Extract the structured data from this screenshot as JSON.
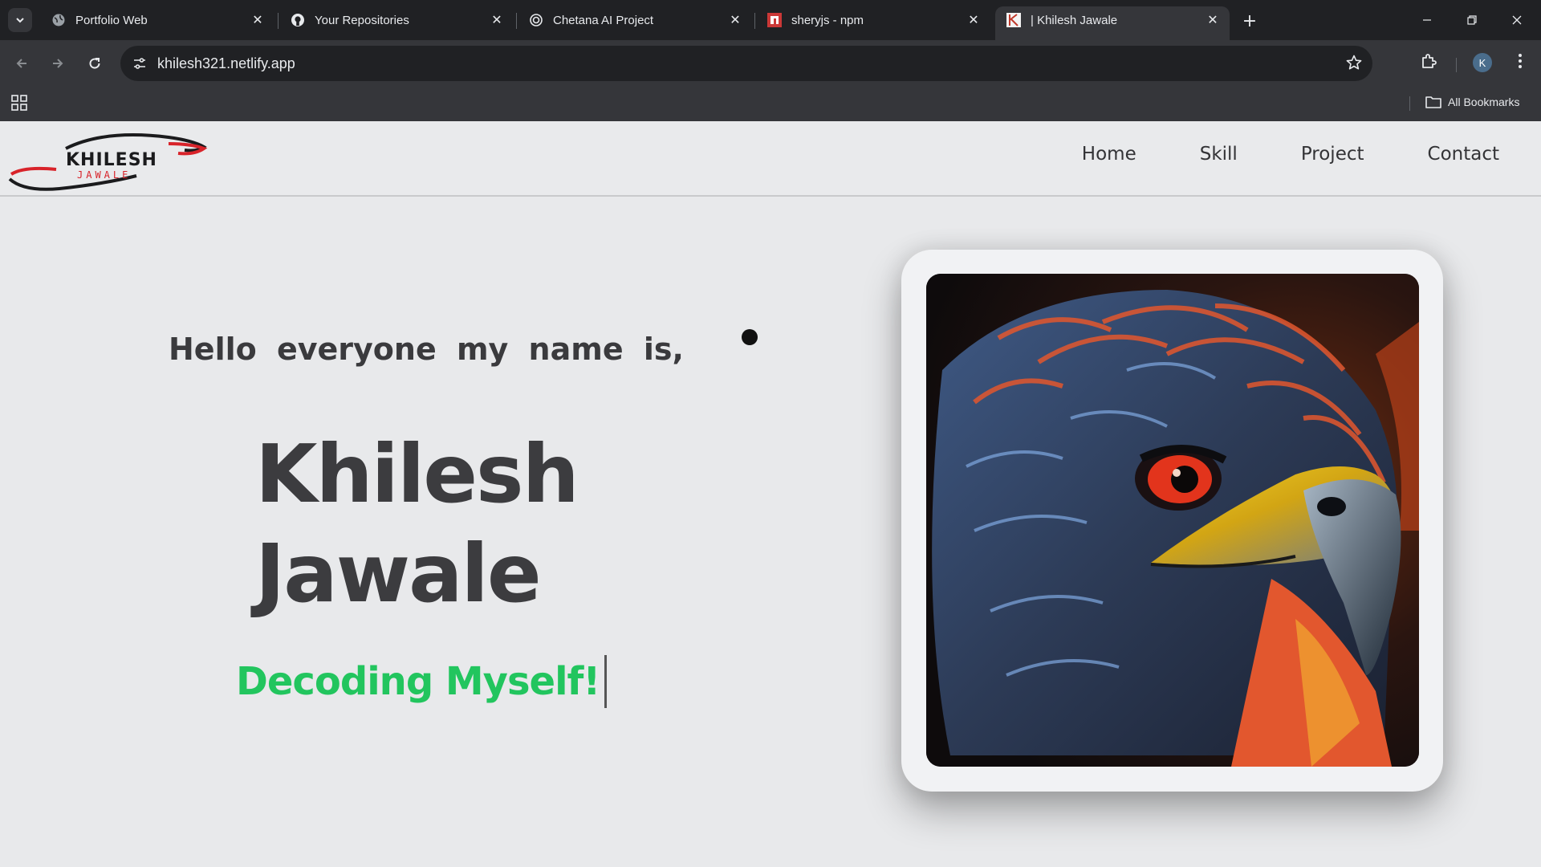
{
  "browser": {
    "tabs": [
      {
        "title": "Portfolio Web",
        "favicon": "globe-icon"
      },
      {
        "title": "Your Repositories",
        "favicon": "github-icon"
      },
      {
        "title": "Chetana AI Project",
        "favicon": "openai-icon"
      },
      {
        "title": "sheryjs - npm",
        "favicon": "npm-icon"
      },
      {
        "title": "| Khilesh Jawale",
        "favicon": "k-logo-icon",
        "active": true
      }
    ],
    "url": "khilesh321.netlify.app",
    "profile_initial": "K",
    "bookmarks_label": "All Bookmarks"
  },
  "site": {
    "logo": {
      "line1": "KHILESH",
      "line2": "JAWALE"
    },
    "nav": [
      "Home",
      "Skill",
      "Project",
      "Contact"
    ],
    "hero": {
      "greeting": "Hello everyone my name is,",
      "first_name": "Khilesh",
      "last_name": "Jawale",
      "tagline": "Decoding Myself!"
    },
    "accent_color": "#22c55e"
  }
}
